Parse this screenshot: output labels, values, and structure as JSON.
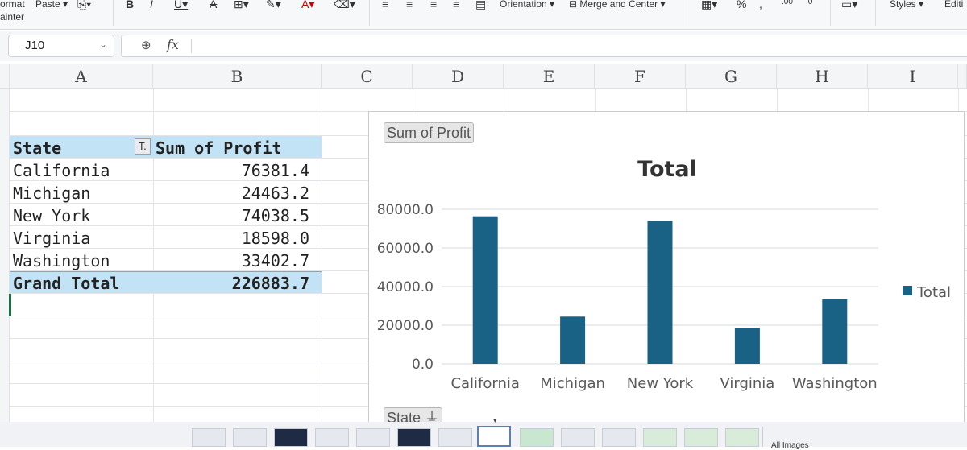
{
  "ribbon": {
    "format_painter_top": "ormat",
    "format_painter_bottom": "ainter",
    "paste_label": "Paste",
    "orientation_label": "Orientation",
    "merge_label": "Merge and Center",
    "styles_label": "Styles",
    "editing_label": "Editi"
  },
  "formula_bar": {
    "cell_ref": "J10",
    "formula": ""
  },
  "columns": [
    "A",
    "B",
    "C",
    "D",
    "E",
    "F",
    "G",
    "H",
    "I"
  ],
  "pivot": {
    "header_state": "State",
    "header_value": "Sum of Profit",
    "rows": [
      {
        "state": "California",
        "profit": "76381.4"
      },
      {
        "state": "Michigan",
        "profit": "24463.2"
      },
      {
        "state": "New York",
        "profit": "74038.5"
      },
      {
        "state": "Virginia",
        "profit": "18598.0"
      },
      {
        "state": "Washington",
        "profit": "33402.7"
      }
    ],
    "total_label": "Grand Total",
    "total_value": "226883.7",
    "header_color": "#c2e3f5"
  },
  "chart": {
    "value_field_button": "Sum of Profit",
    "axis_field_button": "State"
  },
  "chart_data": {
    "type": "bar",
    "title": "Total",
    "categories": [
      "California",
      "Michigan",
      "New York",
      "Virginia",
      "Washington"
    ],
    "series": [
      {
        "name": "Total",
        "values": [
          76381.4,
          24463.2,
          74038.5,
          18598.0,
          33402.7
        ],
        "color": "#1a6186"
      }
    ],
    "ylim": [
      0,
      80000
    ],
    "yticks": [
      "0.0",
      "20000.0",
      "40000.0",
      "60000.0",
      "80000.0"
    ],
    "grid": true,
    "legend_position": "right"
  },
  "thumbnails": {
    "all_images_label": "All Images"
  }
}
